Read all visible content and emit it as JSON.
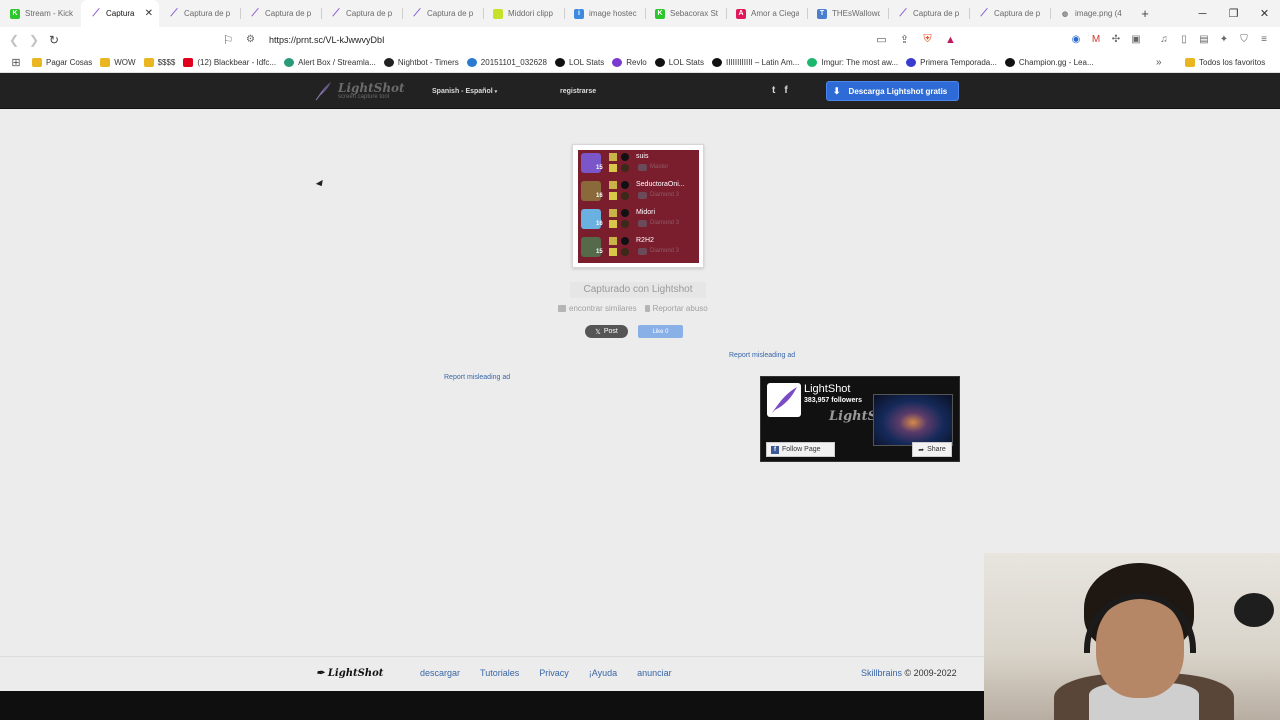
{
  "tabs": [
    {
      "title": "Stream - Kick",
      "icon": "kick-icon",
      "color": "#2dc72d",
      "glyph": "K"
    },
    {
      "title": "Captura",
      "icon": "lightshot-feather-icon",
      "color": "#8a5bd6",
      "glyph": "",
      "active": true
    },
    {
      "title": "Captura de p",
      "icon": "lightshot-feather-icon",
      "color": "#8a5bd6",
      "glyph": ""
    },
    {
      "title": "Captura de p",
      "icon": "lightshot-feather-icon",
      "color": "#8a5bd6",
      "glyph": ""
    },
    {
      "title": "Captura de p",
      "icon": "lightshot-feather-icon",
      "color": "#8a5bd6",
      "glyph": ""
    },
    {
      "title": "Captura de p",
      "icon": "lightshot-feather-icon",
      "color": "#8a5bd6",
      "glyph": ""
    },
    {
      "title": "Middori clipp",
      "icon": "clip-icon",
      "color": "#c7e02a",
      "glyph": ""
    },
    {
      "title": "image hostec",
      "icon": "image-host-icon",
      "color": "#3c8be0",
      "glyph": "i"
    },
    {
      "title": "Sebacorax St",
      "icon": "kick-icon",
      "color": "#2dc72d",
      "glyph": "K"
    },
    {
      "title": "Amor a Ciega",
      "icon": "bookmark-icon",
      "color": "#e0185a",
      "glyph": "A"
    },
    {
      "title": "THEsWallowd",
      "icon": "dictionary-icon",
      "color": "#4a7fd0",
      "glyph": "T"
    },
    {
      "title": "Captura de p",
      "icon": "lightshot-feather-icon",
      "color": "#8a5bd6",
      "glyph": ""
    },
    {
      "title": "Captura de p",
      "icon": "lightshot-feather-icon",
      "color": "#8a5bd6",
      "glyph": ""
    },
    {
      "title": "image.png (4",
      "icon": "globe-icon",
      "color": "#777777",
      "glyph": ""
    }
  ],
  "active_tab_close": "✕",
  "new_tab": "+",
  "url": "https://prnt.sc/VL-kJwwvyDbI",
  "bookmarks": [
    {
      "label": "Pagar Cosas",
      "type": "folder"
    },
    {
      "label": "WOW",
      "type": "folder"
    },
    {
      "label": "$$$$",
      "type": "folder"
    },
    {
      "label": "(12) Blackbear - Idfc...",
      "type": "youtube",
      "color": "#e0001b"
    },
    {
      "label": "Alert Box / Streamla...",
      "type": "site",
      "color": "#2a9a7a"
    },
    {
      "label": "Nightbot - Timers",
      "type": "site",
      "color": "#222222"
    },
    {
      "label": "20151101_032628",
      "type": "site",
      "color": "#2a7ad0"
    },
    {
      "label": "LOL Stats",
      "type": "site",
      "color": "#111111"
    },
    {
      "label": "Revlo",
      "type": "site",
      "color": "#7a3ad0"
    },
    {
      "label": "LOL Stats",
      "type": "site",
      "color": "#111111"
    },
    {
      "label": "IIIIIIIIIIII – Latin Am...",
      "type": "site",
      "color": "#111111"
    },
    {
      "label": "Imgur: The most aw...",
      "type": "site",
      "color": "#1bb76e"
    },
    {
      "label": "Primera Temporada...",
      "type": "site",
      "color": "#3a3ad0"
    },
    {
      "label": "Champion.gg - Lea...",
      "type": "site",
      "color": "#111111"
    }
  ],
  "bookmarks_more": "»",
  "bookmarks_all": "Todos los favoritos",
  "site": {
    "logo": "LightShot",
    "logo_sub": "screen capture tool",
    "language": "Spanish - Español",
    "register": "registrarse",
    "download": "Descarga Lightshot gratis",
    "twitter": "t",
    "facebook": "f"
  },
  "screenshot_players": [
    {
      "level": "15",
      "name": "suis",
      "rank": "Master",
      "color": "#7a56c9"
    },
    {
      "level": "16",
      "name": "SeductoraOni...",
      "rank": "Diamond 3",
      "color": "#8a6a3a"
    },
    {
      "level": "16",
      "name": "Midori",
      "rank": "Diamond 3",
      "color": "#6ab0e0"
    },
    {
      "level": "15",
      "name": "R2H2",
      "rank": "Diamond 3",
      "color": "#556a4a"
    }
  ],
  "caption": "Capturado con Lightshot",
  "find_similar": "encontrar similares",
  "report_abuse": "Reportar abuso",
  "tweet": "Post",
  "like": "Like 0",
  "ad_link_right": "Report misleading ad",
  "ad_link_left": "Report misleading ad",
  "fb_widget": {
    "name": "LightShot",
    "followers": "383,957 followers",
    "watermark": "LightShot",
    "follow": "Follow Page",
    "share": "Share"
  },
  "footer": {
    "logo": "LightShot",
    "links": [
      "descargar",
      "Tutoriales",
      "Privacy",
      "¡Ayuda",
      "anunciar"
    ],
    "company": "Skillbrains",
    "copyright": " © 2009-2022"
  }
}
